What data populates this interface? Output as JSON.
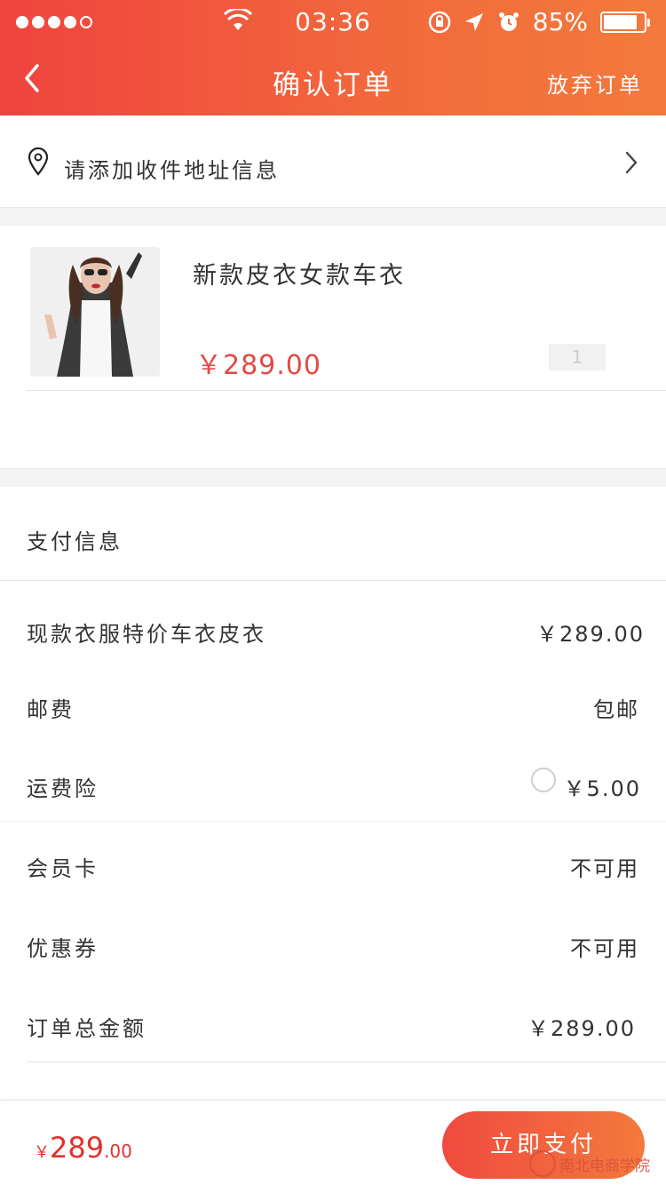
{
  "status_bar": {
    "time": "03:36",
    "battery": "85%",
    "battery_level": 0.85,
    "signal_dots": 5,
    "signal_filled": 4
  },
  "nav": {
    "title": "确认订单",
    "abandon_label": "放弃订单"
  },
  "address": {
    "prompt": "请添加收件地址信息"
  },
  "product": {
    "name": "新款皮衣女款车衣",
    "price": "￥289.00",
    "quantity": "1"
  },
  "payment": {
    "section_title": "支付信息",
    "rows": [
      {
        "label": "现款衣服特价车衣皮衣",
        "value": "￥289.00"
      },
      {
        "label": "邮费",
        "value": "包邮"
      },
      {
        "label": "运费险",
        "value": "￥5.00"
      },
      {
        "label": "会员卡",
        "value": "不可用"
      },
      {
        "label": "优惠券",
        "value": "不可用"
      },
      {
        "label": "订单总金额",
        "value": "￥289.00"
      }
    ]
  },
  "footer": {
    "currency": "￥",
    "total_int": "289",
    "total_dec": ".00",
    "pay_button": "立即支付"
  },
  "watermark": {
    "text": "南北电商学院"
  },
  "colors": {
    "accent": "#f0433e",
    "accent_end": "#f37a3d",
    "price": "#e24a43"
  }
}
